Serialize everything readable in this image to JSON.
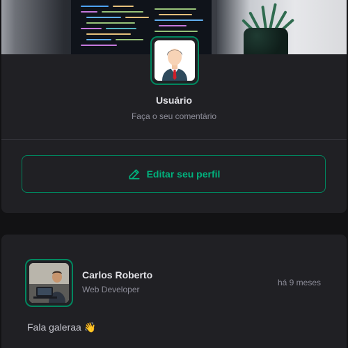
{
  "profile": {
    "name": "Usuário",
    "subtitle": "Faça o seu comentário",
    "edit_label": "Editar seu perfil",
    "avatar_icon": "user-avatar-icon",
    "accent": "#00875f",
    "accent_text": "#00b37e"
  },
  "post": {
    "author": "Carlos Roberto",
    "role": "Web Developer",
    "time": "há 9 meses",
    "content": "Fala galeraa 👋"
  }
}
